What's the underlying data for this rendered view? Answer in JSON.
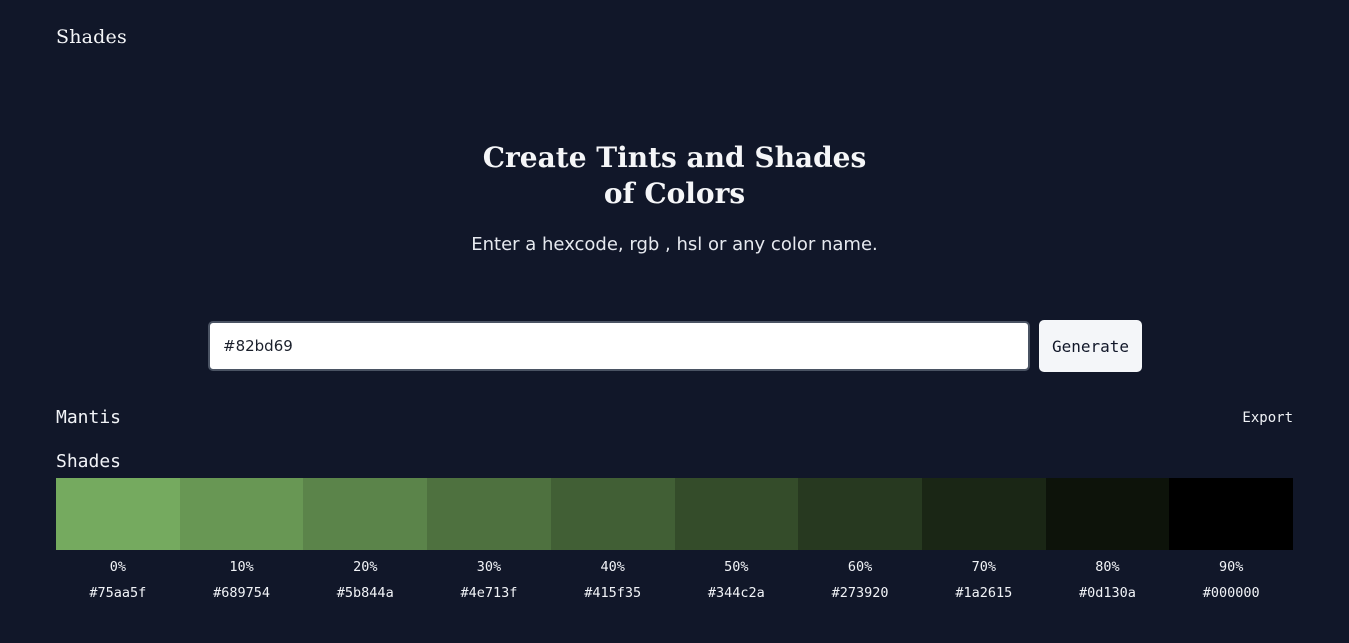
{
  "header": {
    "brand": "Shades"
  },
  "hero": {
    "title": "Create Tints and Shades of Colors",
    "subtitle": "Enter a hexcode, rgb , hsl or any color name."
  },
  "form": {
    "input_value": "#82bd69",
    "input_placeholder": "",
    "generate_label": "Generate"
  },
  "result": {
    "color_name": "Mantis",
    "export_label": "Export",
    "section_label": "Shades",
    "shades": [
      {
        "percent": "0%",
        "hex": "#75aa5f"
      },
      {
        "percent": "10%",
        "hex": "#689754"
      },
      {
        "percent": "20%",
        "hex": "#5b844a"
      },
      {
        "percent": "30%",
        "hex": "#4e713f"
      },
      {
        "percent": "40%",
        "hex": "#415f35"
      },
      {
        "percent": "50%",
        "hex": "#344c2a"
      },
      {
        "percent": "60%",
        "hex": "#273920"
      },
      {
        "percent": "70%",
        "hex": "#1a2615"
      },
      {
        "percent": "80%",
        "hex": "#0d130a"
      },
      {
        "percent": "90%",
        "hex": "#000000"
      }
    ]
  },
  "colors": {
    "background": "#111729",
    "text": "#f1f3f7",
    "input_background": "#ffffff",
    "button_background": "#f4f6f9"
  }
}
